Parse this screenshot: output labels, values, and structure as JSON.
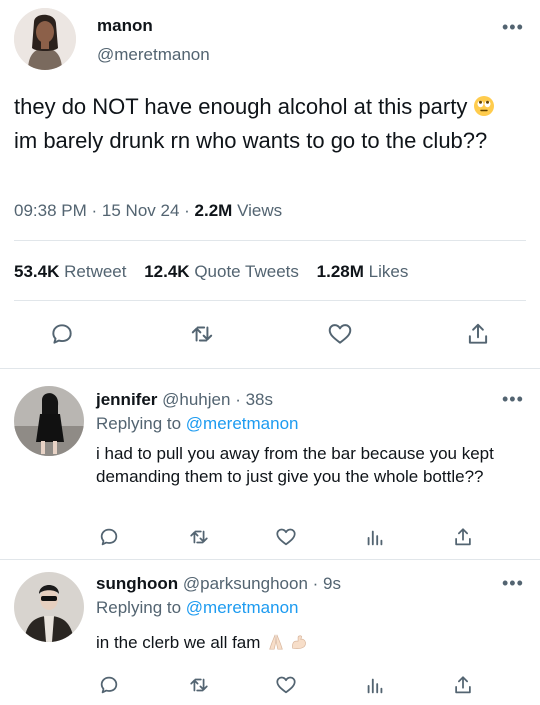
{
  "main_tweet": {
    "display_name": "manon",
    "handle": "@meretmanon",
    "text_part1": "they do NOT have enough alcohol at this party",
    "emoji": "rolling-eyes-emoji",
    "text_part2": "im barely drunk rn who wants to go to the club??",
    "time": "09:38 PM",
    "date": "15 Nov 24",
    "views_count": "2.2M",
    "views_label": "Views",
    "retweets_count": "53.4K",
    "retweets_label": "Retweet",
    "quotes_count": "12.4K",
    "quotes_label": "Quote Tweets",
    "likes_count": "1.28M",
    "likes_label": "Likes"
  },
  "replies": [
    {
      "display_name": "jennifer",
      "handle": "@huhjen",
      "time": "38s",
      "replying_label": "Replying to",
      "replying_to": "@meretmanon",
      "text": "i had to pull you away from the bar because you kept demanding them to just give you the whole bottle??"
    },
    {
      "display_name": "sunghoon",
      "handle": "@parksunghoon",
      "time": "9s",
      "replying_label": "Replying to",
      "replying_to": "@meretmanon",
      "text": "in the clerb we all fam",
      "emojis": [
        "folded-hands-emoji",
        "flexed-biceps-emoji"
      ]
    }
  ],
  "separator": "·",
  "more_glyph": "•••",
  "colors": {
    "accent": "#1d9bf0",
    "secondary_text": "#536471",
    "primary_text": "#0f1419",
    "divider": "#e1e6ea"
  }
}
